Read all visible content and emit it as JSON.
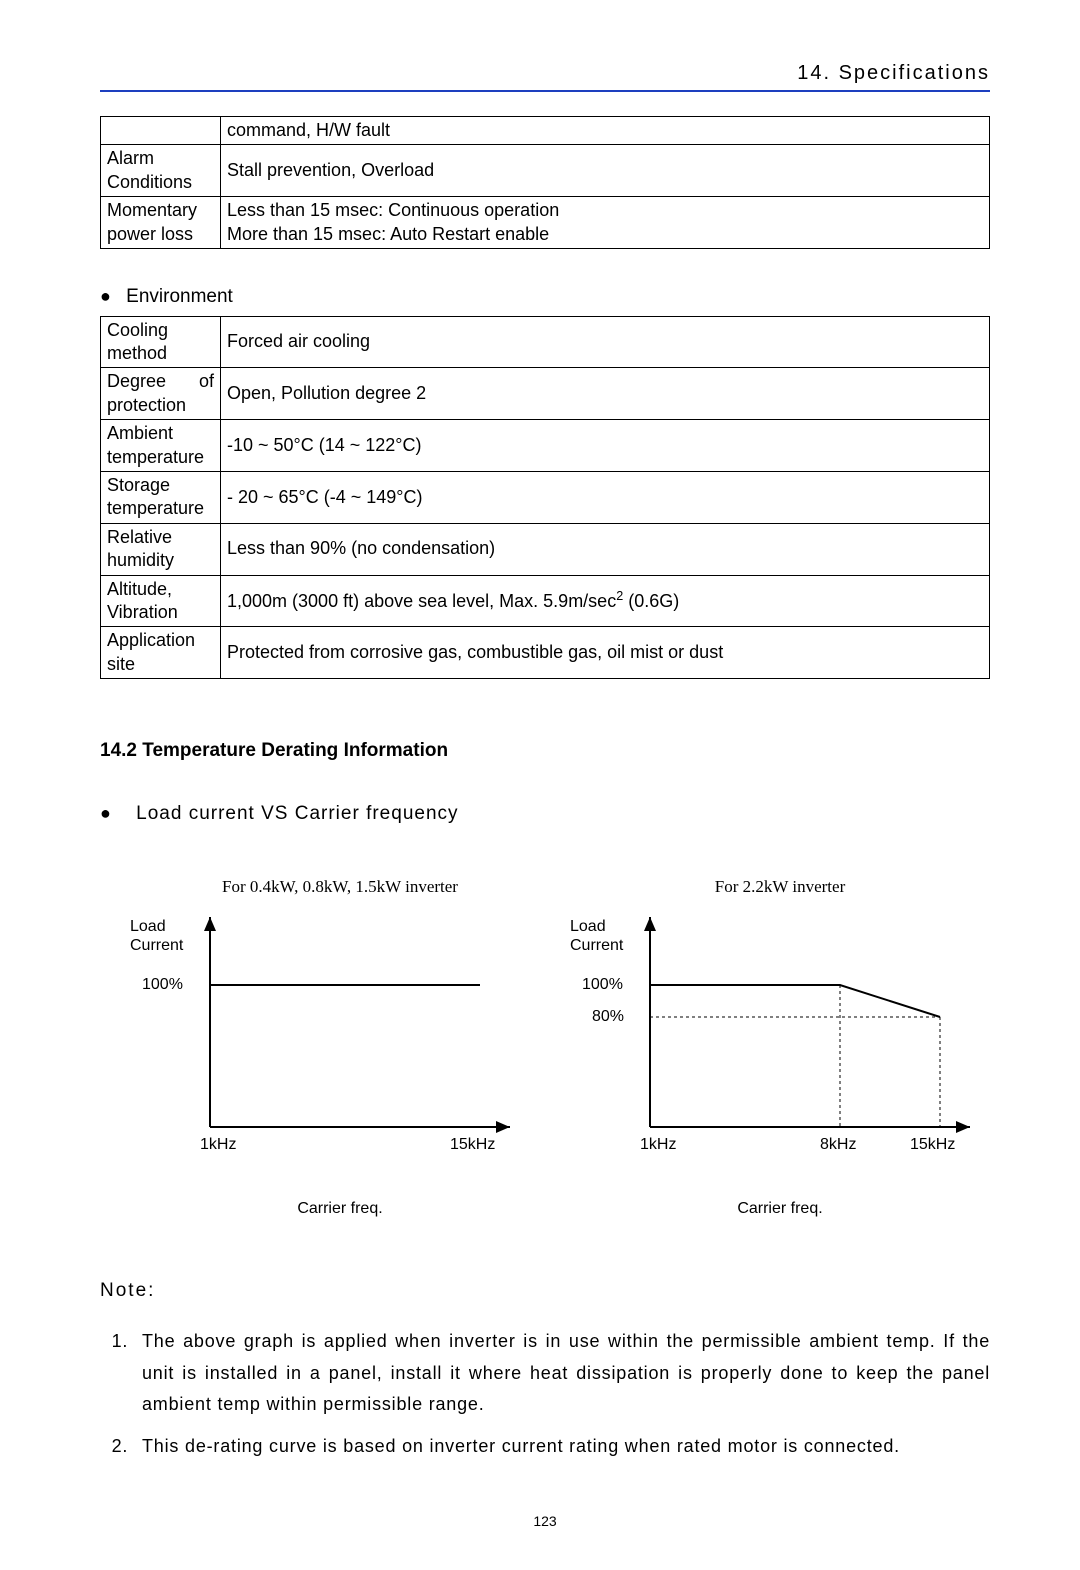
{
  "header": {
    "chapter": "14. Specifications"
  },
  "table1": {
    "rows": [
      {
        "label": "",
        "value": "command, H/W fault"
      },
      {
        "label": "Alarm Conditions",
        "value": "Stall prevention, Overload"
      },
      {
        "label": "Momentary power loss",
        "value": "Less than 15 msec: Continuous operation\nMore than 15 msec: Auto Restart enable"
      }
    ]
  },
  "env_heading": "Environment",
  "table2": {
    "rows": [
      {
        "label": "Cooling method",
        "value": "Forced air cooling"
      },
      {
        "label": "Degree of protection",
        "value": "Open, Pollution degree 2"
      },
      {
        "label": "Ambient temperature",
        "value": "-10 ~ 50°C (14 ~ 122°C)"
      },
      {
        "label": "Storage temperature",
        "value": "- 20 ~ 65°C (-4 ~ 149°C)"
      },
      {
        "label": "Relative humidity",
        "value": "Less than 90% (no condensation)"
      },
      {
        "label": "Altitude, Vibration",
        "value_html": "1,000m (3000 ft) above sea level, Max. 5.9m/sec<sup>2</sup> (0.6G)"
      },
      {
        "label": "Application site",
        "value": "Protected from corrosive gas, combustible gas, oil mist or dust"
      }
    ]
  },
  "section_14_2": "14.2 Temperature Derating Information",
  "subbullet": "Load current VS Carrier frequency",
  "chart_data": [
    {
      "type": "line",
      "title": "For 0.4kW, 0.8kW, 1.5kW inverter",
      "ylabel": "Load Current",
      "xlabel": "Carrier freq.",
      "x": [
        1,
        15
      ],
      "y": [
        100,
        100
      ],
      "y_ticks": [
        100
      ],
      "y_tick_labels": [
        "100%"
      ],
      "x_ticks": [
        1,
        15
      ],
      "x_tick_labels": [
        "1kHz",
        "15kHz"
      ],
      "xlim": [
        1,
        15
      ],
      "ylim": [
        0,
        110
      ]
    },
    {
      "type": "line",
      "title": "For 2.2kW inverter",
      "ylabel": "Load Current",
      "xlabel": "Carrier freq.",
      "x": [
        1,
        8,
        15
      ],
      "y": [
        100,
        100,
        80
      ],
      "y_ticks": [
        80,
        100
      ],
      "y_tick_labels": [
        "80%",
        "100%"
      ],
      "x_ticks": [
        1,
        8,
        15
      ],
      "x_tick_labels": [
        "1kHz",
        "8kHz",
        "15kHz"
      ],
      "xlim": [
        1,
        15
      ],
      "ylim": [
        0,
        110
      ]
    }
  ],
  "note_title": "Note:",
  "notes": [
    "The above graph is applied when inverter is in use within the permissible ambient temp. If the unit is installed in a panel, install it where heat dissipation is properly done to keep the panel ambient temp within permissible range.",
    "This de-rating curve is based on inverter current rating when rated motor is connected."
  ],
  "page_number": "123"
}
